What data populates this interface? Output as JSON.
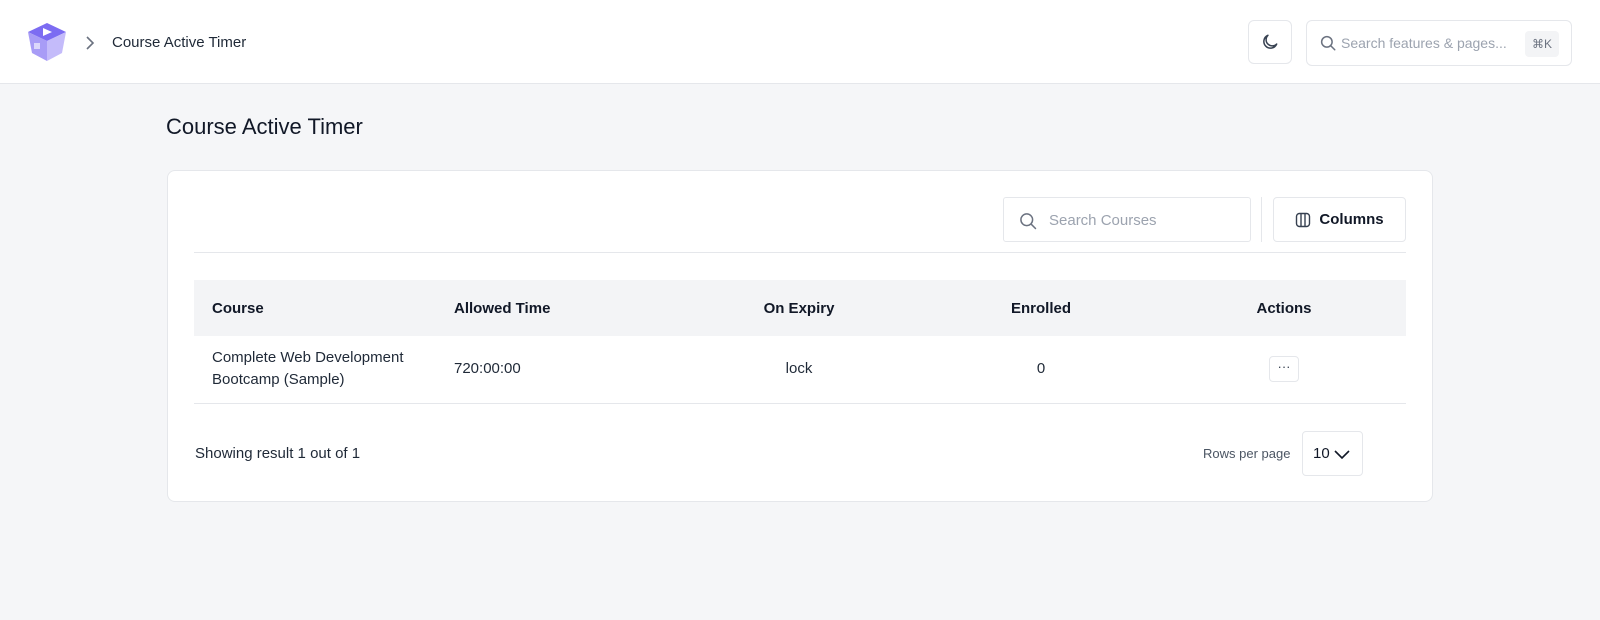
{
  "header": {
    "breadcrumb_title": "Course Active Timer",
    "search_placeholder": "Search features & pages...",
    "search_shortcut": "⌘K",
    "brand_color": "#7c6cf2"
  },
  "page": {
    "title": "Course Active Timer"
  },
  "toolbar": {
    "search_placeholder": "Search Courses",
    "columns_label": "Columns"
  },
  "table": {
    "headers": [
      "Course",
      "Allowed Time",
      "On Expiry",
      "Enrolled",
      "Actions"
    ],
    "rows": [
      {
        "course": "Complete Web Development Bootcamp (Sample)",
        "allowed_time": "720:00:00",
        "on_expiry": "lock",
        "enrolled": "0",
        "actions_label": "···"
      }
    ]
  },
  "footer": {
    "showing": "Showing result 1 out of 1",
    "rows_per_page_label": "Rows per page",
    "rows_per_page_value": "10"
  },
  "icons": [
    "logo-icon",
    "chevron-right-icon",
    "moon-icon",
    "search-icon",
    "columns-icon",
    "chevron-down-icon"
  ]
}
